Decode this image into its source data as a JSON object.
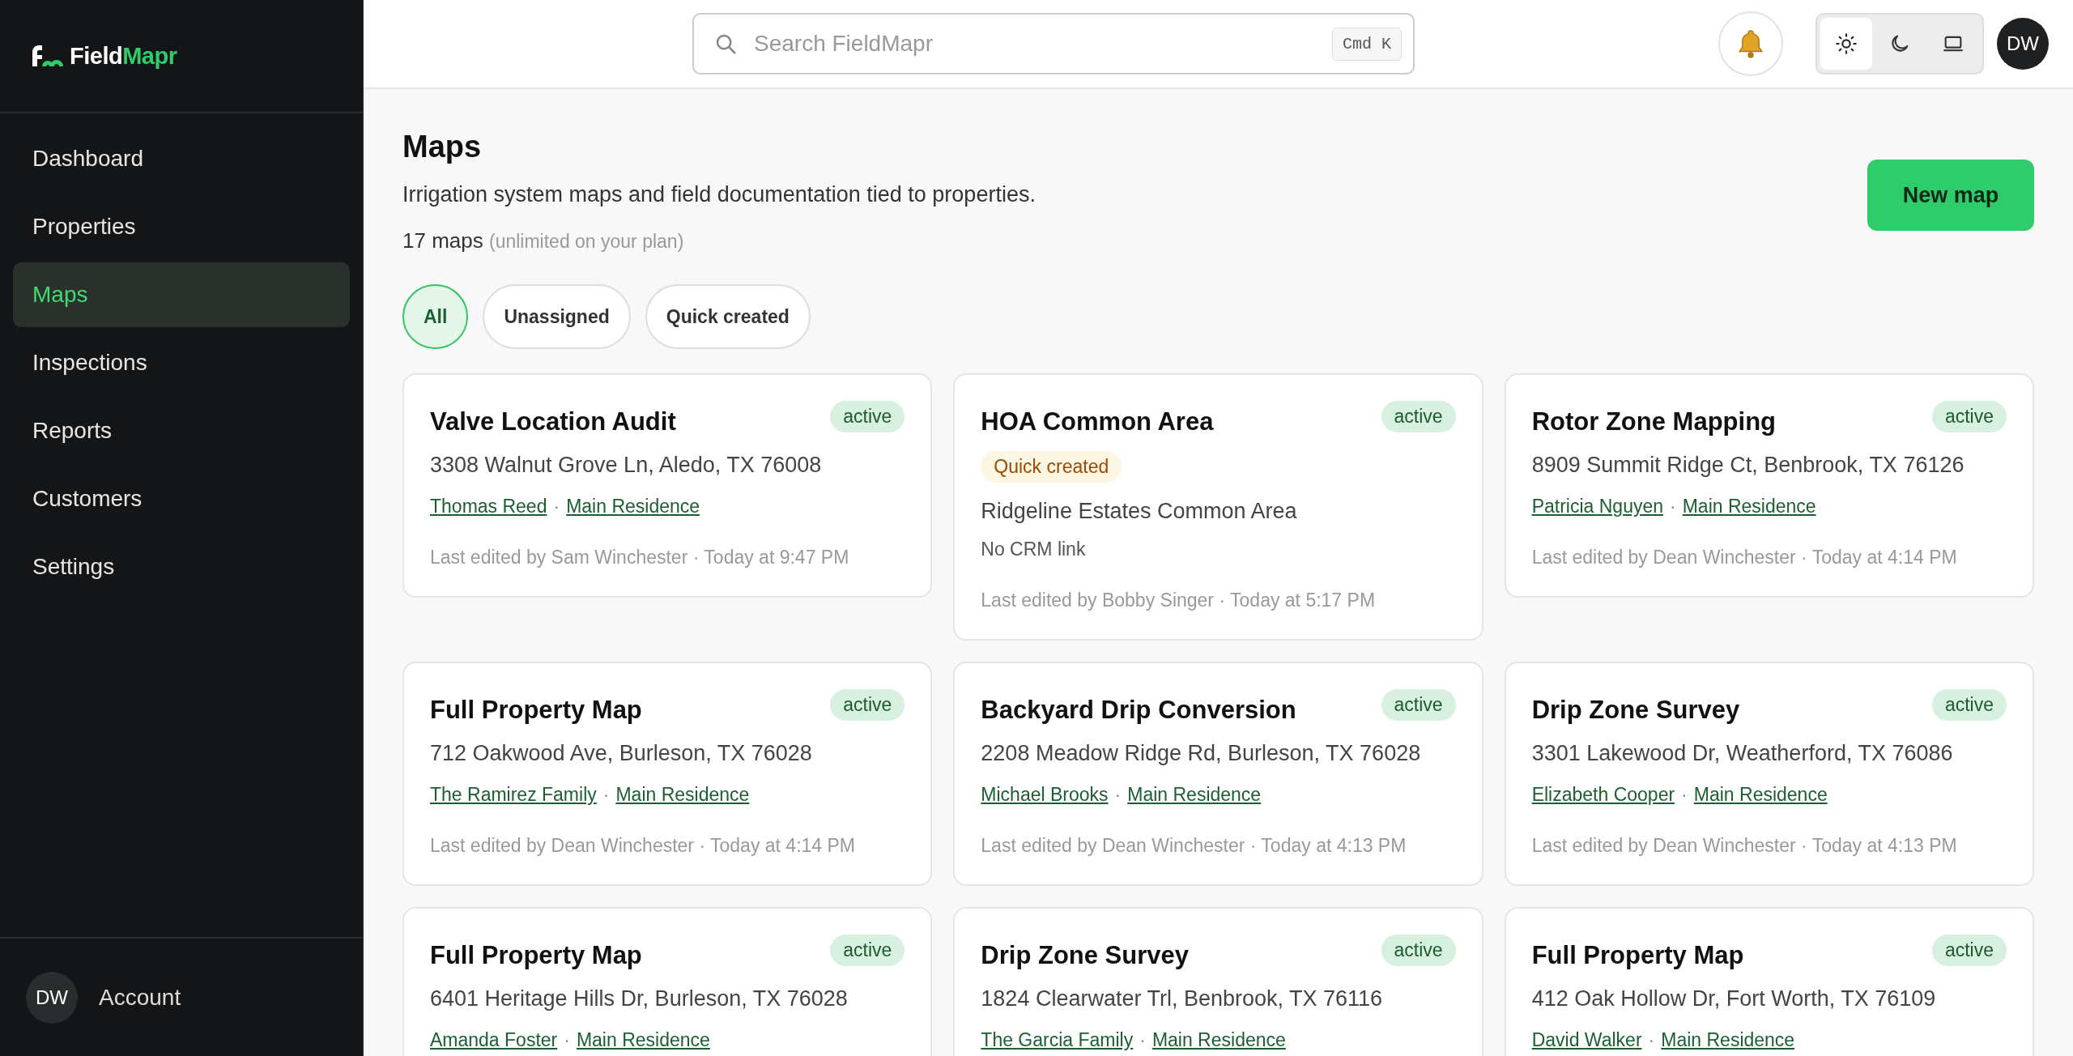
{
  "brand": {
    "name": "Field",
    "accent": "Mapr"
  },
  "sidebar": {
    "items": [
      {
        "label": "Dashboard",
        "selected": false
      },
      {
        "label": "Properties",
        "selected": false
      },
      {
        "label": "Maps",
        "selected": true
      },
      {
        "label": "Inspections",
        "selected": false
      },
      {
        "label": "Reports",
        "selected": false
      },
      {
        "label": "Customers",
        "selected": false
      },
      {
        "label": "Settings",
        "selected": false
      }
    ],
    "account": {
      "initials": "DW",
      "label": "Account"
    }
  },
  "header": {
    "search": {
      "placeholder": "Search FieldMapr",
      "shortcut": "Cmd K"
    },
    "theme_options": [
      {
        "kind": "light",
        "selected": true
      },
      {
        "kind": "dark",
        "selected": false
      },
      {
        "kind": "system",
        "selected": false
      }
    ],
    "avatar": "DW"
  },
  "page": {
    "title": "Maps",
    "subtitle": "Irrigation system maps and field documentation tied to properties.",
    "count": "17 maps",
    "count_note": "(unlimited on your plan)",
    "new_button": "New map"
  },
  "filters": [
    {
      "label": "All",
      "selected": true
    },
    {
      "label": "Unassigned",
      "selected": false
    },
    {
      "label": "Quick created",
      "selected": false
    }
  ],
  "cards": [
    {
      "title": "Valve Location Audit",
      "status": "active",
      "place": "3308 Walnut Grove Ln, Aledo, TX 76008",
      "links": [
        "Thomas Reed",
        "Main Residence"
      ],
      "separator": "·",
      "edited": "Last edited by Sam Winchester · Today at 9:47 PM"
    },
    {
      "title": "HOA Common Area",
      "status": "active",
      "tag": "Quick created",
      "place": "Ridgeline Estates Common Area",
      "note": "No CRM link",
      "edited": "Last edited by Bobby Singer · Today at 5:17 PM"
    },
    {
      "title": "Rotor Zone Mapping",
      "status": "active",
      "place": "8909 Summit Ridge Ct, Benbrook, TX 76126",
      "links": [
        "Patricia Nguyen",
        "Main Residence"
      ],
      "separator": "·",
      "edited": "Last edited by Dean Winchester · Today at 4:14 PM"
    },
    {
      "title": "Full Property Map",
      "status": "active",
      "place": "712 Oakwood Ave, Burleson, TX 76028",
      "links": [
        "The Ramirez Family",
        "Main Residence"
      ],
      "separator": "·",
      "edited": "Last edited by Dean Winchester · Today at 4:14 PM"
    },
    {
      "title": "Backyard Drip Conversion",
      "status": "active",
      "place": "2208 Meadow Ridge Rd, Burleson, TX 76028",
      "links": [
        "Michael Brooks",
        "Main Residence"
      ],
      "separator": "·",
      "edited": "Last edited by Dean Winchester · Today at 4:13 PM"
    },
    {
      "title": "Drip Zone Survey",
      "status": "active",
      "place": "3301 Lakewood Dr, Weatherford, TX 76086",
      "links": [
        "Elizabeth Cooper",
        "Main Residence"
      ],
      "separator": "·",
      "edited": "Last edited by Dean Winchester · Today at 4:13 PM"
    },
    {
      "title": "Full Property Map",
      "status": "active",
      "place": "6401 Heritage Hills Dr, Burleson, TX 76028",
      "links": [
        "Amanda Foster",
        "Main Residence"
      ],
      "separator": "·"
    },
    {
      "title": "Drip Zone Survey",
      "status": "active",
      "place": "1824 Clearwater Trl, Benbrook, TX 76116",
      "links": [
        "The Garcia Family",
        "Main Residence"
      ],
      "separator": "·"
    },
    {
      "title": "Full Property Map",
      "status": "active",
      "place": "412 Oak Hollow Dr, Fort Worth, TX 76109",
      "links": [
        "David Walker",
        "Main Residence"
      ],
      "separator": "·"
    }
  ]
}
